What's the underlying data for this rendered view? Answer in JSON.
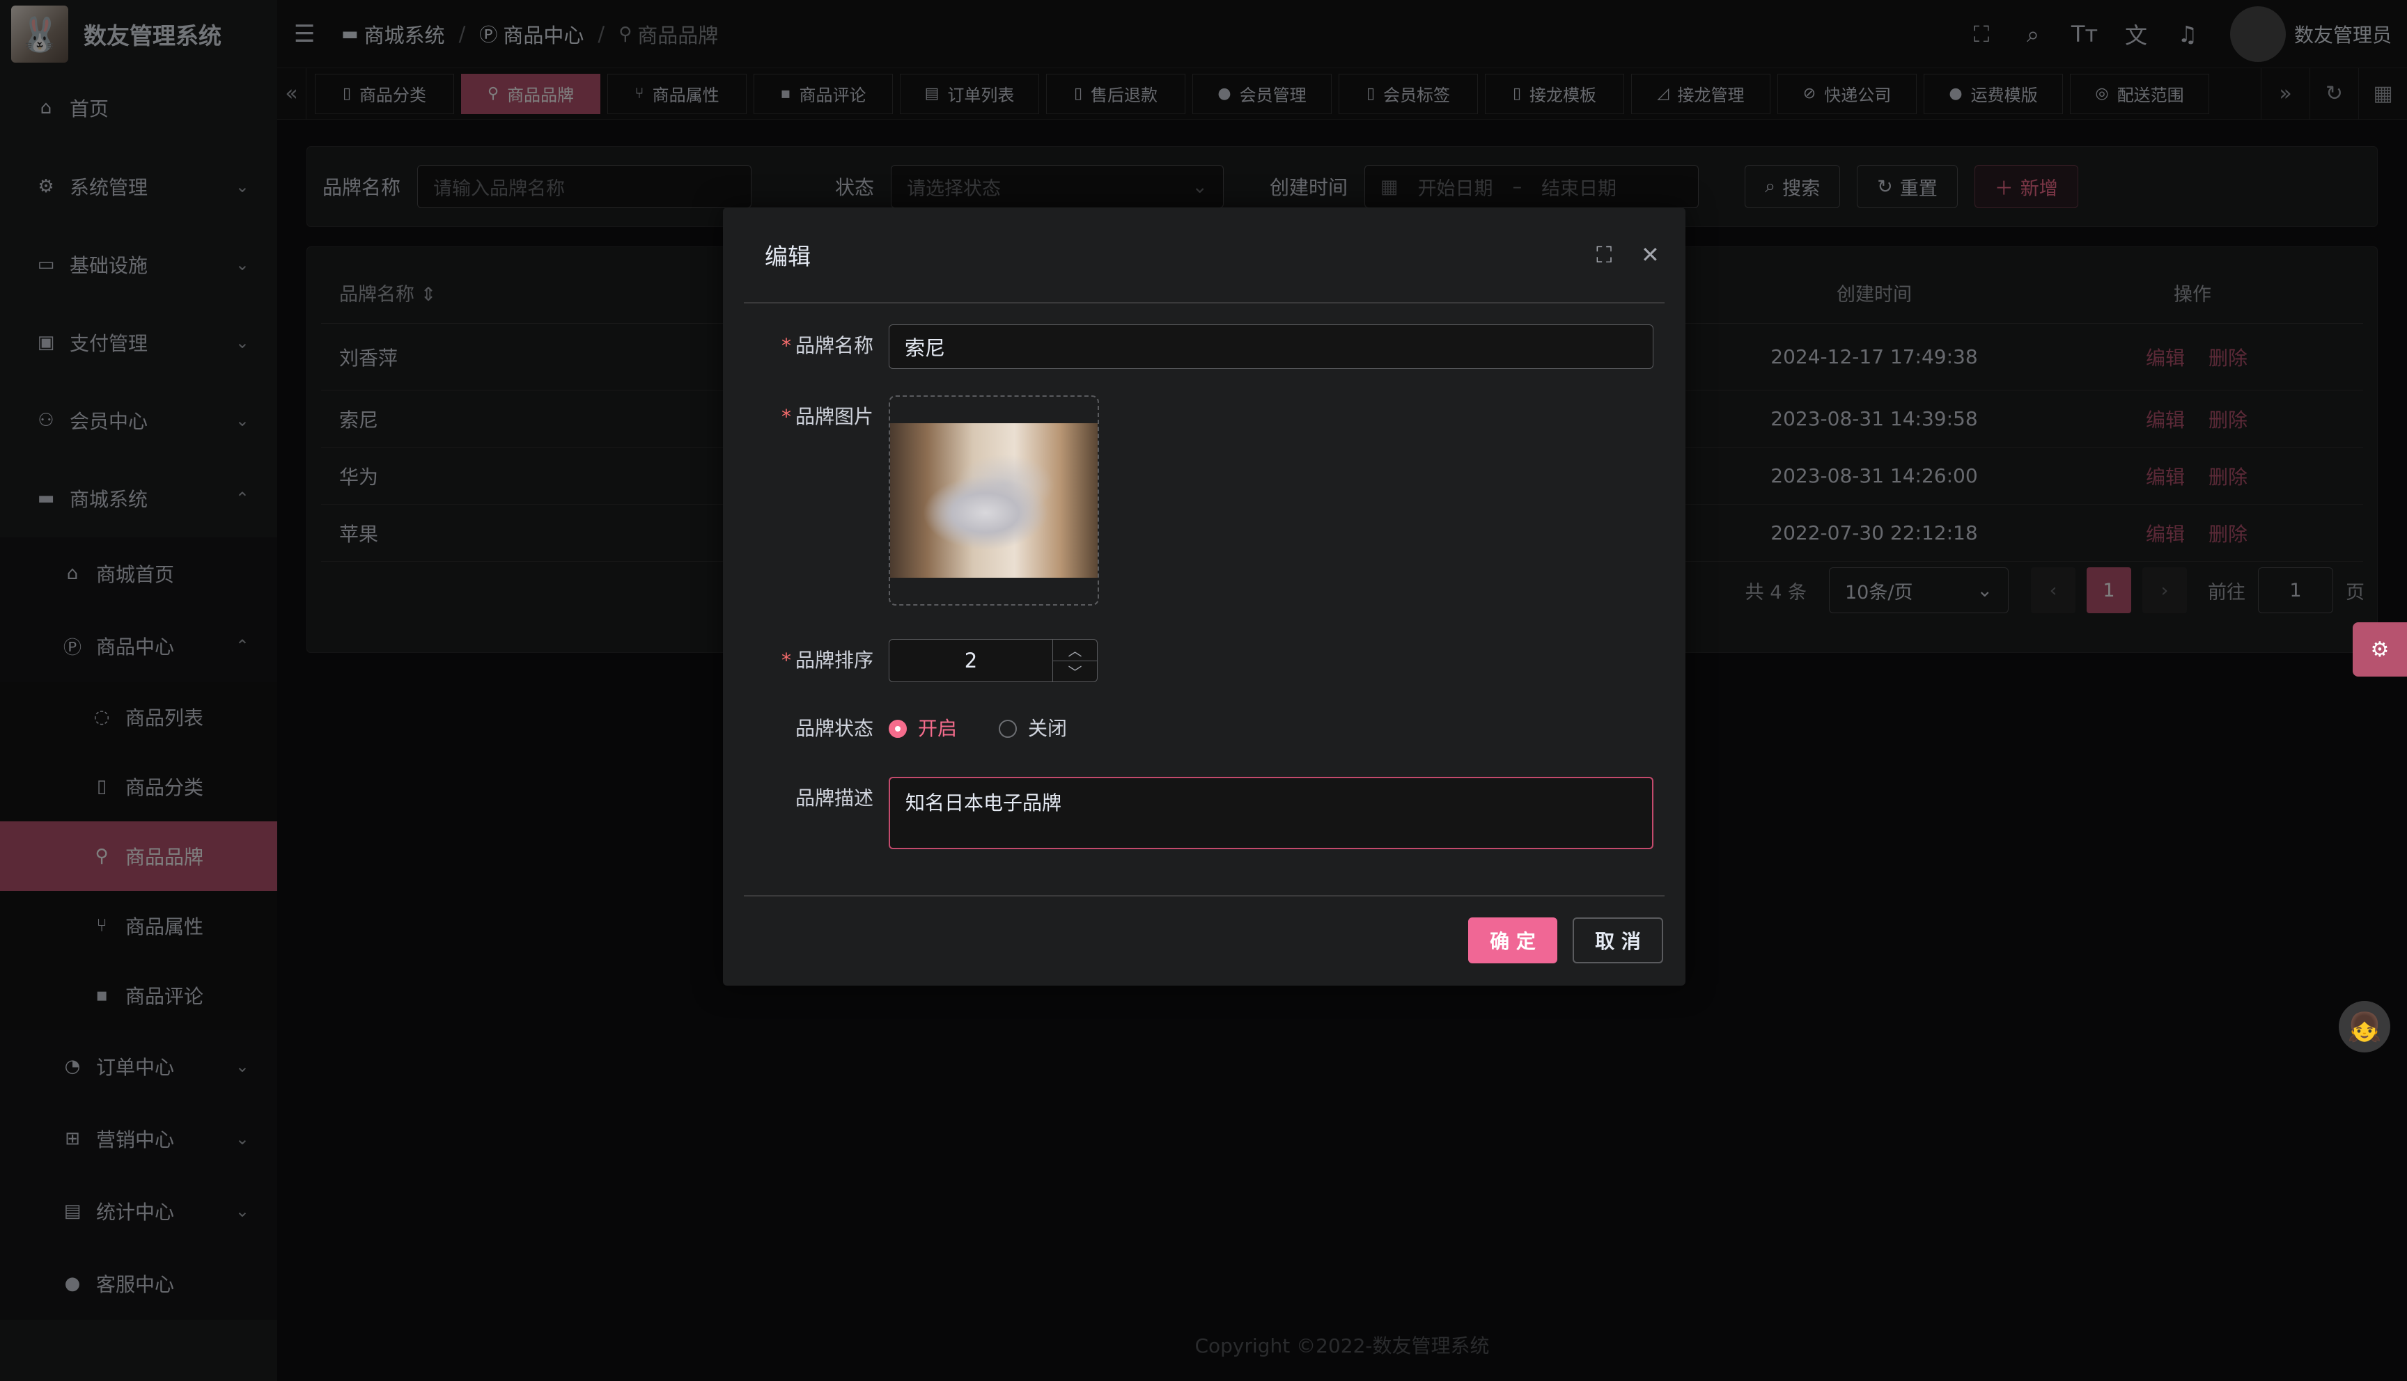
{
  "app": {
    "title": "数友管理系统"
  },
  "sidebar": {
    "items": [
      {
        "label": "首页",
        "icon": "home-icon"
      },
      {
        "label": "系统管理",
        "icon": "gear-icon"
      },
      {
        "label": "基础设施",
        "icon": "monitor-icon"
      },
      {
        "label": "支付管理",
        "icon": "wallet-icon"
      },
      {
        "label": "会员中心",
        "icon": "users-icon"
      },
      {
        "label": "商城系统",
        "icon": "shop-icon"
      }
    ],
    "mall": [
      {
        "label": "商城首页",
        "icon": "home-icon"
      },
      {
        "label": "商品中心",
        "icon": "p-icon"
      }
    ],
    "goods": [
      {
        "label": "商品列表",
        "icon": "apple-icon"
      },
      {
        "label": "商品分类",
        "icon": "doc-icon"
      },
      {
        "label": "商品品牌",
        "icon": "link-icon"
      },
      {
        "label": "商品属性",
        "icon": "filter-icon"
      },
      {
        "label": "商品评论",
        "icon": "comment-icon"
      }
    ],
    "more": [
      {
        "label": "订单中心",
        "icon": "order-icon"
      },
      {
        "label": "营销中心",
        "icon": "gift-icon"
      },
      {
        "label": "统计中心",
        "icon": "chart-icon"
      },
      {
        "label": "客服中心",
        "icon": "user-icon"
      }
    ]
  },
  "header": {
    "breadcrumbs": [
      "商城系统",
      "商品中心",
      "商品品牌"
    ],
    "user": "数友管理员"
  },
  "tabs": [
    "商品分类",
    "商品品牌",
    "商品属性",
    "商品评论",
    "订单列表",
    "售后退款",
    "会员管理",
    "会员标签",
    "接龙模板",
    "接龙管理",
    "快递公司",
    "运费模版",
    "配送范围"
  ],
  "search": {
    "name_label": "品牌名称",
    "name_placeholder": "请输入品牌名称",
    "status_label": "状态",
    "status_placeholder": "请选择状态",
    "time_label": "创建时间",
    "start_placeholder": "开始日期",
    "range_sep": "–",
    "end_placeholder": "结束日期",
    "search_btn": "搜索",
    "reset_btn": "重置",
    "add_btn": "新增"
  },
  "table": {
    "columns": {
      "name": "品牌名称",
      "time": "创建时间",
      "op": "操作"
    },
    "rows": [
      {
        "name": "刘香萍",
        "time": "2024-12-17 17:49:38"
      },
      {
        "name": "索尼",
        "time": "2023-08-31 14:39:58"
      },
      {
        "name": "华为",
        "time": "2023-08-31 14:26:00"
      },
      {
        "name": "苹果",
        "time": "2022-07-30 22:12:18"
      }
    ],
    "edit": "编辑",
    "delete": "删除"
  },
  "pager": {
    "total": "共 4 条",
    "size": "10条/页",
    "current": "1",
    "goto": "前往",
    "goto_value": "1",
    "page": "页"
  },
  "footer": "Copyright ©2022-数友管理系统",
  "dialog": {
    "title": "编辑",
    "name_label": "品牌名称",
    "name_value": "索尼",
    "image_label": "品牌图片",
    "sort_label": "品牌排序",
    "sort_value": "2",
    "status_label": "品牌状态",
    "status_on": "开启",
    "status_off": "关闭",
    "status_selected": "开启",
    "desc_label": "品牌描述",
    "desc_value": "知名日本电子品牌",
    "ok": "确 定",
    "cancel": "取 消"
  },
  "colors": {
    "accent": "#b7536f",
    "primary_btn": "#f06795"
  }
}
